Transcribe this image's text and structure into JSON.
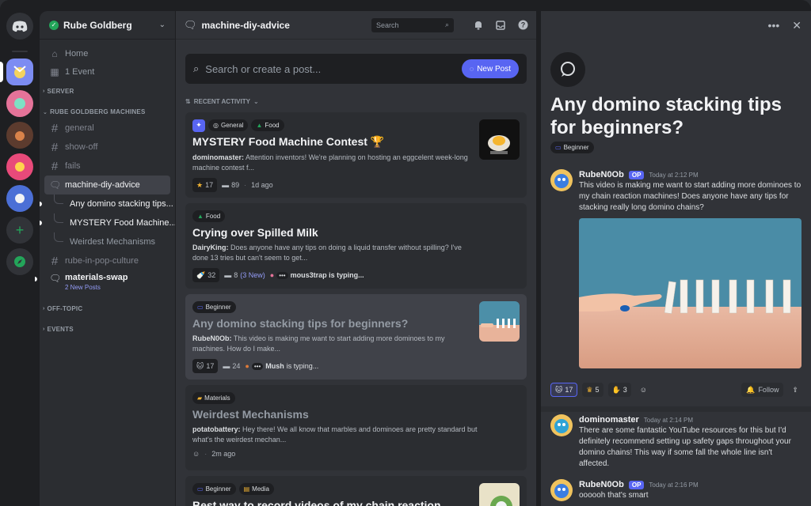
{
  "server": {
    "name": "Rube Goldberg",
    "nav": [
      {
        "label": "Home",
        "icon": "home-icon"
      },
      {
        "label": "1 Event",
        "icon": "calendar-icon"
      }
    ],
    "categories": {
      "server": "SERVER",
      "rgm": "RUBE GOLDBERG MACHINES",
      "offtopic": "OFF-TOPIC",
      "events": "EVENTS"
    },
    "channels": {
      "general": "general",
      "showoff": "show-off",
      "fails": "fails",
      "forum": "machine-diy-advice",
      "thread1": "Any domino stacking tips...",
      "thread2": "MYSTERY Food Machine...",
      "thread3": "Weirdest Mechanisms",
      "rube_pop": "rube-in-pop-culture",
      "swap": "materials-swap",
      "swap_sub": "2 New Posts"
    }
  },
  "forum": {
    "title": "machine-diy-advice",
    "search_placeholder": "Search",
    "query_placeholder": "Search or create a post...",
    "new_post": "New Post",
    "sort_label": "RECENT ACTIVITY",
    "posts": [
      {
        "tags": [
          "General",
          "Food"
        ],
        "title": "MYSTERY Food Machine Contest",
        "author": "dominomaster:",
        "body": "Attention inventors! We're planning on hosting an eggcelent week-long machine contest f...",
        "reaction": "17",
        "messages": "89",
        "time": "1d ago"
      },
      {
        "tags": [
          "Food"
        ],
        "title": "Crying over Spilled Milk",
        "author": "DairyKing:",
        "body": "Does anyone have any tips on doing a liquid transfer without spilling? I've done 13 tries but can't seem to get...",
        "reaction": "32",
        "messages": "8",
        "new_count": "(3 New)",
        "typing": "mous3trap is typing..."
      },
      {
        "tags": [
          "Beginner"
        ],
        "title": "Any domino stacking tips for beginners?",
        "author": "RubeN0Ob:",
        "body": "This video is making me want to start adding more dominoes to my machines. How do I make...",
        "reaction": "17",
        "messages": "24",
        "typing_name": "Mush",
        "typing_rest": "is typing..."
      },
      {
        "tags": [
          "Materials"
        ],
        "title": "Weirdest Mechanisms",
        "author": "potatobattery:",
        "body": "Hey there! We all know that marbles and dominoes are pretty standard but what's the weirdest mechan...",
        "time": "2m ago"
      },
      {
        "tags": [
          "Beginner",
          "Media"
        ],
        "title": "Best way to record videos of my chain reaction"
      }
    ]
  },
  "thread": {
    "title": "Any domino stacking tips for beginners?",
    "tag": "Beginner",
    "messages": [
      {
        "author": "RubeN0Ob",
        "badge": "OP",
        "time": "Today at 2:12 PM",
        "text": "This video is making me want to start adding more dominoes to my chain reaction machines! Does anyone have any tips for stacking really long domino chains?"
      },
      {
        "author": "dominomaster",
        "time": "Today at 2:14 PM",
        "text": "There are some fantastic YouTube resources for this but I'd definitely recommend setting up safety gaps throughout your domino chains! This way if some fall the whole line isn't affected."
      },
      {
        "author": "RubeN0Ob",
        "badge": "OP",
        "time": "Today at 2:16 PM",
        "text": "oooooh that's smart"
      }
    ],
    "reactions": [
      "17",
      "5",
      "3"
    ],
    "follow": "Follow"
  },
  "colors": {
    "accent": "#5865f2",
    "online": "#23a55a"
  }
}
